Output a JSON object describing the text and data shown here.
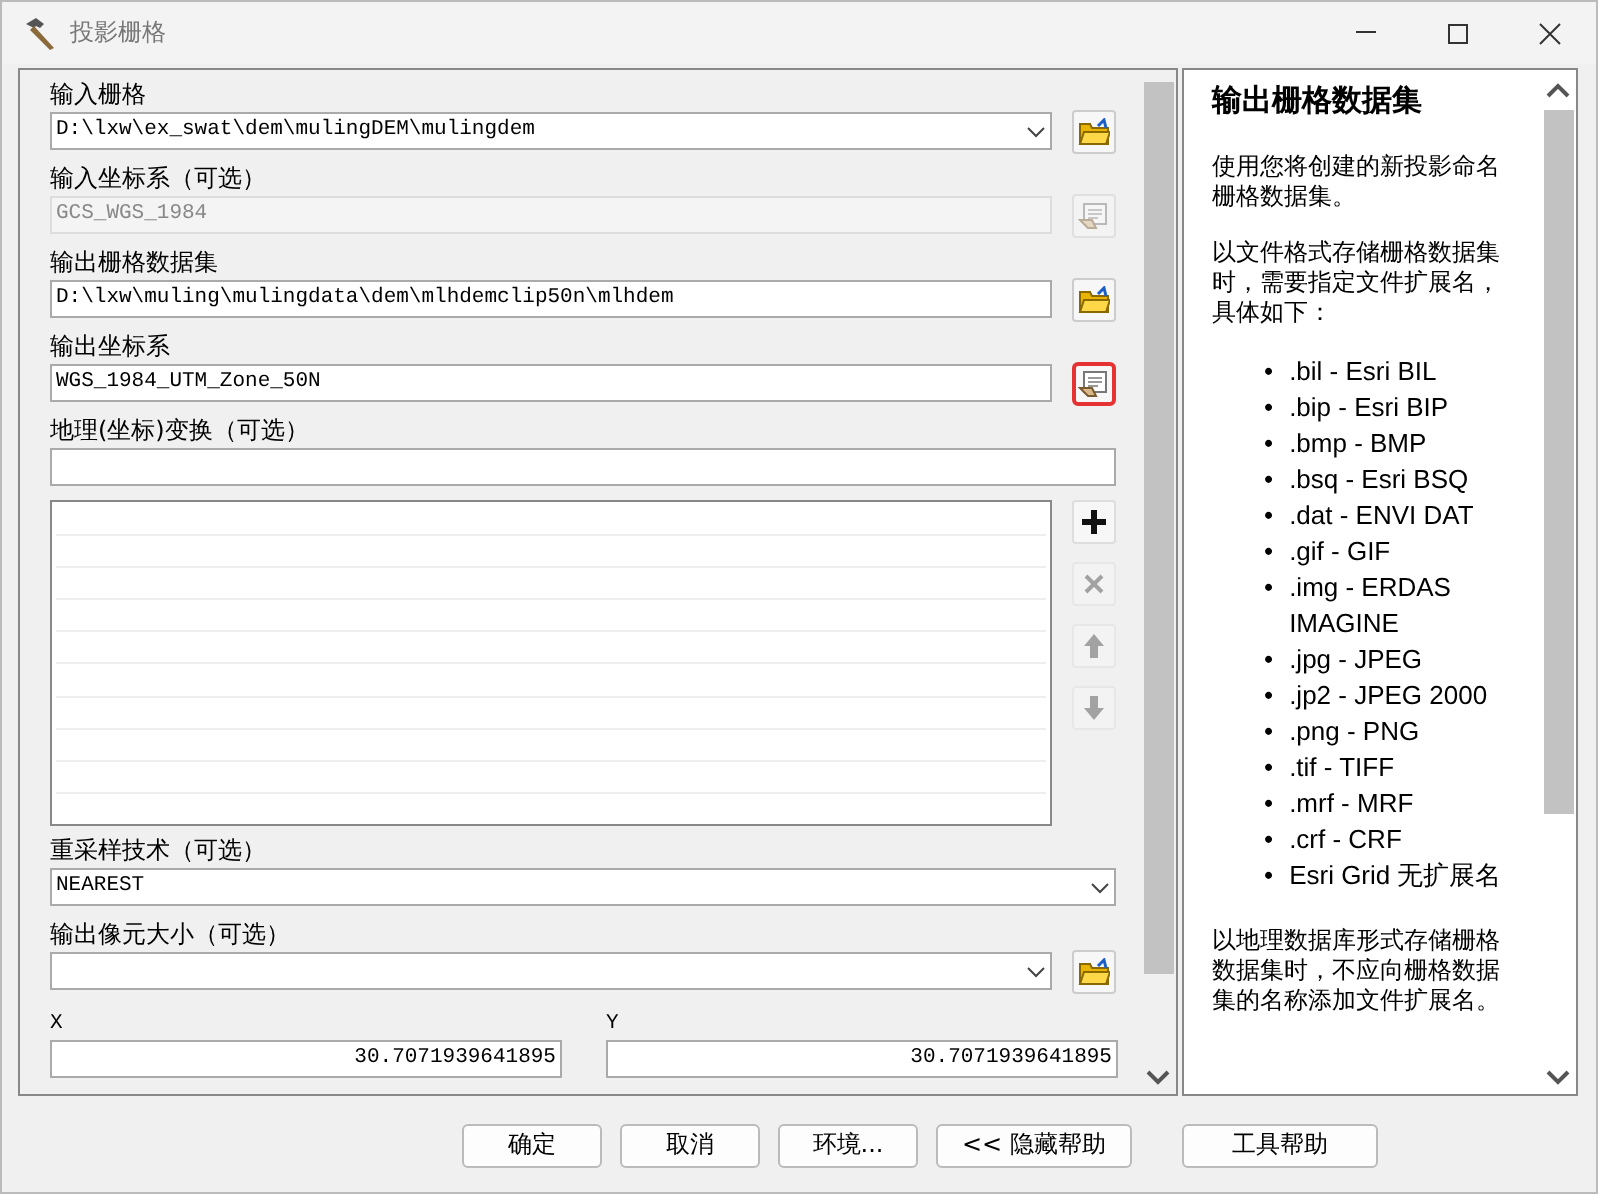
{
  "window": {
    "title": "投影栅格"
  },
  "params": [
    {
      "kind": "dropdown",
      "label": "输入栅格",
      "value": "D:\\lxw\\ex_swat\\dem\\mulingDEM\\mulingdem",
      "disabled": false,
      "action": {
        "kind": "folder",
        "disabled": false,
        "highlighted": false
      }
    },
    {
      "kind": "text",
      "label": "输入坐标系（可选）",
      "value": "GCS_WGS_1984",
      "disabled": true,
      "action": {
        "kind": "properties",
        "disabled": true,
        "highlighted": false
      }
    },
    {
      "kind": "text",
      "label": "输出栅格数据集",
      "value": "D:\\lxw\\muling\\mulingdata\\dem\\mlhdemclip50n\\mlhdem",
      "disabled": false,
      "action": {
        "kind": "folder",
        "disabled": false,
        "highlighted": false
      }
    },
    {
      "kind": "text",
      "label": "输出坐标系",
      "value": "WGS_1984_UTM_Zone_50N",
      "disabled": false,
      "action": {
        "kind": "properties",
        "disabled": false,
        "highlighted": true
      }
    },
    {
      "kind": "list",
      "label": "地理(坐标)变换（可选）",
      "disabled": false
    },
    {
      "kind": "dropdown",
      "label": "重采样技术（可选）",
      "value": "NEAREST",
      "disabled": false
    },
    {
      "kind": "combo",
      "label": "输出像元大小（可选）",
      "disabled": false,
      "action": {
        "kind": "folder",
        "disabled": false,
        "highlighted": false
      }
    },
    {
      "kind": "xy",
      "label": "X",
      "value": "30.7071939641895",
      "label2": "Y",
      "value2": "30.7071939641895",
      "disabled": false
    }
  ],
  "list_tools": [
    {
      "kind": "add",
      "disabled": false
    },
    {
      "kind": "remove",
      "disabled": true
    },
    {
      "kind": "up",
      "disabled": true
    },
    {
      "kind": "down",
      "disabled": true
    }
  ],
  "help": {
    "title": "输出栅格数据集",
    "paragraphs_before": [
      "使用您将创建的新投影命名栅格数据集。",
      "以文件格式存储栅格数据集时，需要指定文件扩展名，具体如下："
    ],
    "bullet": "•",
    "items": [
      ".bil - Esri BIL",
      ".bip - Esri BIP",
      ".bmp - BMP",
      ".bsq - Esri BSQ",
      ".dat - ENVI DAT",
      ".gif - GIF",
      ".img - ERDAS IMAGINE",
      ".jpg - JPEG",
      ".jp2 - JPEG 2000",
      ".png - PNG",
      ".tif - TIFF",
      ".mrf - MRF",
      ".crf - CRF",
      "Esri Grid 无扩展名"
    ],
    "paragraphs_after": [
      "以地理数据库形式存储栅格数据集时，不应向栅格数据集的名称添加文件扩展名。"
    ]
  },
  "buttons": [
    "确定",
    "取消",
    "环境...",
    "<< 隐藏帮助"
  ],
  "help_button": "工具帮助"
}
